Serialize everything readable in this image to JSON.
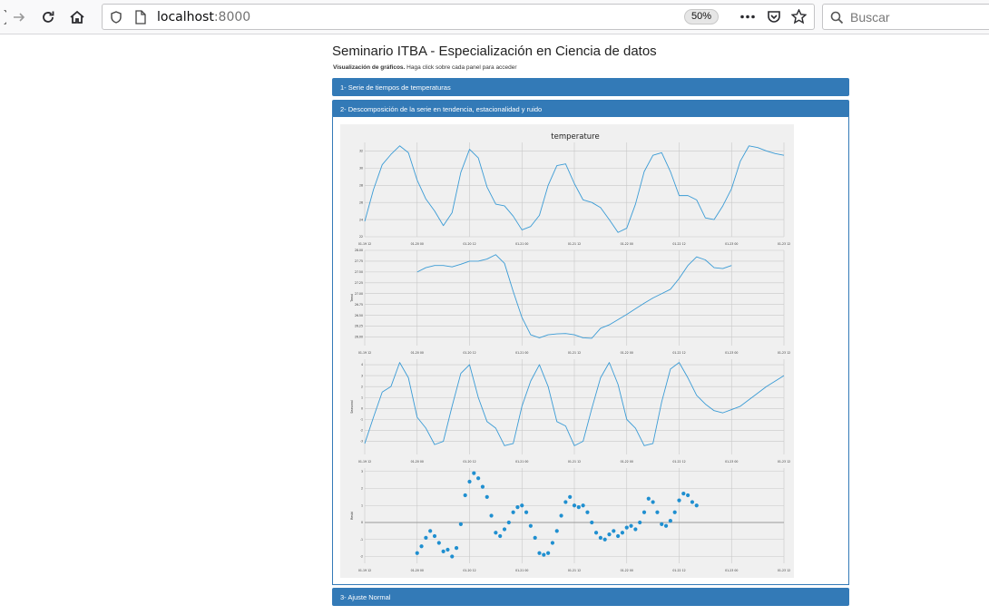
{
  "browser": {
    "url_host": "localhost",
    "url_port": ":8000",
    "zoom": "50%",
    "search_placeholder": "Buscar"
  },
  "page": {
    "title": "Seminario ITBA - Especialización en Ciencia de datos",
    "subtitle_bold": "Visualización de gráficos.",
    "subtitle_rest": " Haga click sobre cada panel para acceder",
    "panels": [
      {
        "label": "1- Serie de tiempos de temperaturas"
      },
      {
        "label": "2- Descomposición de la serie en tendencia, estacionalidad y ruido"
      },
      {
        "label": "3- Ajuste Normal"
      }
    ]
  },
  "chart_data": {
    "type": "line",
    "title": "temperature",
    "x_ticks": [
      "01-19 12",
      "01-20 00",
      "01-20 12",
      "01-21 00",
      "01-21 12",
      "01-22 00",
      "01-22 12",
      "01-23 00",
      "01-23 12"
    ],
    "x_range": [
      0,
      96
    ],
    "grid": true,
    "panels": [
      {
        "name": "observed",
        "ylabel": "",
        "style": "line",
        "color": "#3a9bd5",
        "ylim": [
          22,
          33
        ],
        "y_ticks": [
          "22",
          "24",
          "26",
          "28",
          "30",
          "32"
        ],
        "y_tick_values": [
          22,
          24,
          26,
          28,
          30,
          32
        ],
        "x": [
          0,
          2,
          4,
          6,
          8,
          10,
          12,
          14,
          16,
          18,
          20,
          22,
          24,
          26,
          28,
          30,
          32,
          34,
          36,
          38,
          40,
          42,
          44,
          46,
          48,
          50,
          52,
          54,
          56,
          58,
          60,
          62,
          64,
          66,
          68,
          70,
          72,
          74,
          76,
          78,
          80,
          82,
          84,
          86,
          88,
          90,
          92,
          94,
          96
        ],
        "values": [
          23.8,
          27.5,
          30.4,
          31.6,
          32.6,
          31.8,
          28.6,
          26.4,
          25.0,
          23.3,
          24.8,
          29.5,
          32.2,
          31.2,
          27.8,
          25.8,
          25.6,
          24.4,
          22.8,
          23.2,
          24.5,
          28.0,
          30.3,
          30.5,
          28.2,
          26.3,
          26.0,
          25.4,
          24.0,
          22.5,
          23.0,
          25.8,
          29.6,
          31.5,
          31.8,
          29.6,
          26.8,
          26.8,
          26.3,
          24.2,
          24.0,
          25.6,
          27.6,
          30.8,
          32.6,
          32.4,
          32.0,
          31.7,
          31.5
        ]
      },
      {
        "name": "trend",
        "ylabel": "Trend",
        "style": "line",
        "color": "#3a9bd5",
        "ylim": [
          25.8,
          28.0
        ],
        "y_ticks": [
          "26.00",
          "26.25",
          "26.50",
          "26.75",
          "27.00",
          "27.25",
          "27.50",
          "27.75",
          "28.00"
        ],
        "y_tick_values": [
          26.0,
          26.25,
          26.5,
          26.75,
          27.0,
          27.25,
          27.5,
          27.75,
          28.0
        ],
        "x": [
          12,
          14,
          16,
          18,
          20,
          22,
          24,
          26,
          28,
          30,
          32,
          34,
          36,
          38,
          40,
          42,
          44,
          46,
          48,
          50,
          52,
          54,
          56,
          58,
          60,
          62,
          64,
          66,
          68,
          70,
          72,
          74,
          76,
          78,
          80,
          82,
          84
        ],
        "values": [
          27.5,
          27.6,
          27.65,
          27.65,
          27.62,
          27.68,
          27.75,
          27.75,
          27.8,
          27.9,
          27.7,
          27.05,
          26.45,
          26.05,
          25.98,
          26.05,
          26.07,
          26.08,
          26.05,
          25.98,
          25.97,
          26.2,
          26.28,
          26.4,
          26.52,
          26.65,
          26.78,
          26.9,
          27.0,
          27.1,
          27.35,
          27.65,
          27.85,
          27.78,
          27.6,
          27.58,
          27.65
        ]
      },
      {
        "name": "seasonal",
        "ylabel": "Seasonal",
        "style": "line",
        "color": "#3a9bd5",
        "ylim": [
          -4.2,
          4.5
        ],
        "y_ticks": [
          "-3",
          "-2",
          "-1",
          "0",
          "1",
          "2",
          "3",
          "4"
        ],
        "y_tick_values": [
          -3,
          -2,
          -1,
          0,
          1,
          2,
          3,
          4
        ],
        "x": [
          0,
          2,
          4,
          6,
          8,
          10,
          12,
          14,
          16,
          18,
          20,
          22,
          24,
          26,
          28,
          30,
          32,
          34,
          36,
          38,
          40,
          42,
          44,
          46,
          48,
          50,
          52,
          54,
          56,
          58,
          60,
          62,
          64,
          66,
          68,
          70,
          72,
          74,
          76,
          78,
          80,
          82,
          84,
          86,
          88,
          90,
          92,
          94,
          96
        ],
        "values": [
          -3.2,
          -0.8,
          1.5,
          2.0,
          4.2,
          2.8,
          -0.8,
          -1.8,
          -3.3,
          -3.0,
          0.2,
          3.2,
          4.0,
          1.0,
          -1.2,
          -1.8,
          -3.4,
          -3.2,
          0.2,
          2.5,
          4.0,
          2.0,
          -1.2,
          -1.6,
          -3.4,
          -3.0,
          0.0,
          2.8,
          4.2,
          2.2,
          -1.0,
          -1.8,
          -3.4,
          -3.2,
          0.6,
          3.6,
          4.2,
          2.8,
          1.2,
          0.4,
          -0.2,
          -0.4,
          -0.1,
          0.2,
          0.8,
          1.4,
          2.0,
          2.5,
          3.0
        ]
      },
      {
        "name": "resid",
        "ylabel": "Resid",
        "style": "scatter",
        "color": "#1f8fd0",
        "ylim": [
          -2.4,
          3.2
        ],
        "y_ticks": [
          "-2",
          "-1",
          "0",
          "1",
          "2",
          "3"
        ],
        "y_tick_values": [
          -2,
          -1,
          0,
          1,
          2,
          3
        ],
        "x": [
          12,
          13,
          14,
          15,
          16,
          17,
          18,
          19,
          20,
          21,
          22,
          23,
          24,
          25,
          26,
          27,
          28,
          29,
          30,
          31,
          32,
          33,
          34,
          35,
          36,
          37,
          38,
          39,
          40,
          41,
          42,
          43,
          44,
          45,
          46,
          47,
          48,
          49,
          50,
          51,
          52,
          53,
          54,
          55,
          56,
          57,
          58,
          59,
          60,
          61,
          62,
          63,
          64,
          65,
          66,
          67,
          68,
          69,
          70,
          71,
          72,
          73,
          74,
          75,
          76,
          77,
          78,
          79,
          80,
          81,
          82,
          83,
          84
        ],
        "values": [
          -1.8,
          -1.4,
          -0.9,
          -0.5,
          -0.8,
          -1.2,
          -1.7,
          -1.6,
          -2.0,
          -1.5,
          -0.1,
          1.6,
          2.4,
          2.9,
          2.6,
          2.1,
          1.5,
          0.4,
          -0.6,
          -0.8,
          -0.4,
          0.0,
          0.6,
          0.9,
          1.0,
          0.6,
          -0.2,
          -0.9,
          -1.8,
          -1.9,
          -1.8,
          -1.2,
          -0.5,
          0.4,
          1.2,
          1.5,
          1.0,
          0.9,
          1.0,
          0.6,
          0.0,
          -0.6,
          -0.9,
          -1.0,
          -0.7,
          -0.5,
          -0.8,
          -0.6,
          -0.3,
          -0.2,
          -0.4,
          0.0,
          0.6,
          1.4,
          1.2,
          0.6,
          -0.1,
          -0.2,
          0.1,
          0.6,
          1.3,
          1.7,
          1.6,
          1.2,
          1.0,
          null,
          null,
          null,
          null,
          null,
          null,
          null,
          null
        ]
      }
    ]
  }
}
